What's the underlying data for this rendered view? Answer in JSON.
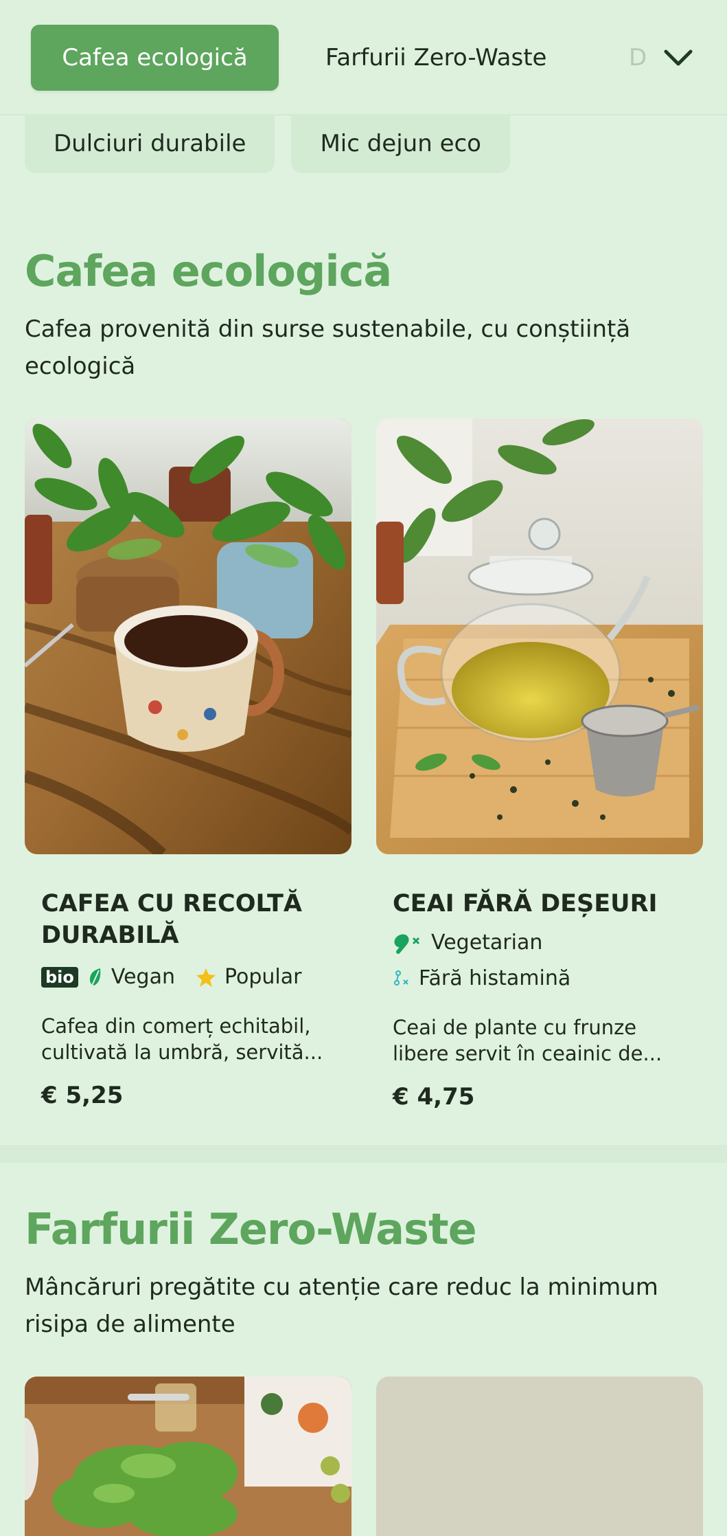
{
  "nav": {
    "tabs": [
      {
        "label": "Cafea ecologică"
      },
      {
        "label": "Farfurii Zero-Waste"
      },
      {
        "label": "D"
      }
    ],
    "chips": [
      {
        "label": "Dulciuri durabile"
      },
      {
        "label": "Mic dejun eco"
      }
    ],
    "expand_icon": "chevron-down-icon"
  },
  "sections": [
    {
      "title": "Cafea ecologică",
      "description": "Cafea provenită din surse sustenabile, cu conștiință ecologică",
      "products": [
        {
          "name": "CAFEA CU RECOLTĂ DURABILĂ",
          "badge": "bio",
          "tag1": "Vegan",
          "tag2": "Popular",
          "description": "Cafea din comerț echitabil, cultivată la umbră, servită...",
          "price": "€ 5,25"
        },
        {
          "name": "CEAI FĂRĂ DEȘEURI",
          "tag1": "Vegetarian",
          "tag2": "Fără histamină",
          "description": "Ceai de plante cu frunze libere servit în ceainic de...",
          "price": "€ 4,75"
        }
      ]
    },
    {
      "title": "Farfurii Zero-Waste",
      "description": "Mâncăruri pregătite cu atenție care reduc la minimum risipa de alimente"
    }
  ],
  "colors": {
    "background": "#dff2df",
    "accent": "#5ea55e",
    "text": "#1f2a1f",
    "vegan_leaf": "#19a35e",
    "popular_star": "#f3c019"
  }
}
